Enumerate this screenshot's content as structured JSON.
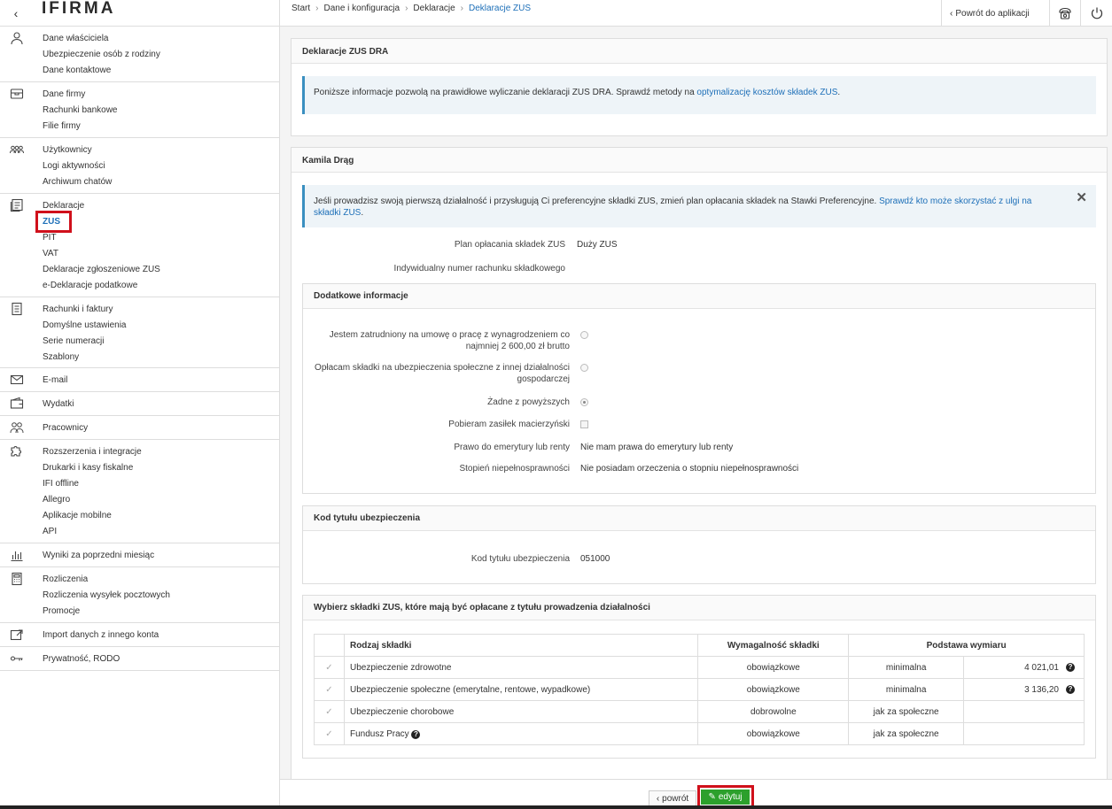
{
  "sidebar": {
    "logo": "IFIRMA",
    "groups": [
      {
        "icon": "user-icon",
        "items": [
          "Dane właściciela",
          "Ubezpieczenie osób z rodziny",
          "Dane kontaktowe"
        ]
      },
      {
        "icon": "company-icon",
        "items": [
          "Dane firmy",
          "Rachunki bankowe",
          "Filie firmy"
        ]
      },
      {
        "icon": "users-icon",
        "items": [
          "Użytkownicy",
          "Logi aktywności",
          "Archiwum chatów"
        ]
      },
      {
        "icon": "declarations-icon",
        "items": [
          "Deklaracje",
          "ZUS",
          "PIT",
          "VAT",
          "Deklaracje zgłoszeniowe ZUS",
          "e-Deklaracje podatkowe"
        ]
      },
      {
        "icon": "invoice-icon",
        "items": [
          "Rachunki i faktury",
          "Domyślne ustawienia",
          "Serie numeracji",
          "Szablony"
        ]
      },
      {
        "icon": "mail-icon",
        "items": [
          "E-mail"
        ]
      },
      {
        "icon": "wallet-icon",
        "items": [
          "Wydatki"
        ]
      },
      {
        "icon": "employees-icon",
        "items": [
          "Pracownicy"
        ]
      },
      {
        "icon": "puzzle-icon",
        "items": [
          "Rozszerzenia i integracje",
          "Drukarki i kasy fiskalne",
          "IFI offline",
          "Allegro",
          "Aplikacje mobilne",
          "API"
        ]
      },
      {
        "icon": "chart-icon",
        "items": [
          "Wyniki za poprzedni miesiąc"
        ]
      },
      {
        "icon": "calculator-icon",
        "items": [
          "Rozliczenia",
          "Rozliczenia wysyłek pocztowych",
          "Promocje"
        ]
      },
      {
        "icon": "import-icon",
        "items": [
          "Import danych z innego konta"
        ]
      },
      {
        "icon": "key-icon",
        "items": [
          "Prywatność, RODO"
        ]
      }
    ]
  },
  "topbar": {
    "breadcrumb": [
      "Start",
      "Dane i konfiguracja",
      "Deklaracje",
      "Deklaracje ZUS"
    ],
    "back_label": "Powrót do aplikacji"
  },
  "panel1": {
    "title": "Deklaracje ZUS DRA",
    "note_text": "Poniższe informacje pozwolą na prawidłowe wyliczanie deklaracji ZUS DRA. Sprawdź metody na ",
    "note_link": "optymalizację kosztów składek ZUS",
    "note_end": "."
  },
  "panel2": {
    "title": "Kamila Drąg",
    "note_text": "Jeśli prowadzisz swoją pierwszą działalność i przysługują Ci preferencyjne składki ZUS, zmień plan opłacania składek na Stawki Preferencyjne. ",
    "note_link": "Sprawdź kto może skorzystać z ulgi na składki ZUS",
    "note_end": ".",
    "plan_label": "Plan opłacania składek ZUS",
    "plan_value": "Duży ZUS",
    "account_label": "Indywidualny numer rachunku składkowego",
    "account_value": ""
  },
  "extra": {
    "title": "Dodatkowe informacje",
    "opt1_line1": "Jestem zatrudniony na umowę o pracę z wynagrodzeniem co",
    "opt1_line2": "najmniej 2 600,00 zł brutto",
    "opt2_line1": "Opłacam składki na ubezpieczenia społeczne z innej działalności",
    "opt2_line2": "gospodarczej",
    "opt3": "Żadne z powyższych",
    "maternity_label": "Pobieram zasiłek macierzyński",
    "pension_label": "Prawo do emerytury lub renty",
    "pension_value": "Nie mam prawa do emerytury lub renty",
    "disability_label": "Stopień niepełnosprawności",
    "disability_value": "Nie posiadam orzeczenia o stopniu niepełnosprawności"
  },
  "code": {
    "title": "Kod tytułu ubezpieczenia",
    "label": "Kod tytułu ubezpieczenia",
    "value": "051000"
  },
  "contrib": {
    "title": "Wybierz składki ZUS, które mają być opłacane z tytułu prowadzenia działalności",
    "headers": [
      "Rodzaj składki",
      "Wymagalność składki",
      "Podstawa wymiaru"
    ],
    "rows": [
      {
        "name": "Ubezpieczenie zdrowotne",
        "req": "obowiązkowe",
        "basis": "minimalna",
        "amount": "4 021,01"
      },
      {
        "name": "Ubezpieczenie społeczne (emerytalne, rentowe, wypadkowe)",
        "req": "obowiązkowe",
        "basis": "minimalna",
        "amount": "3 136,20"
      },
      {
        "name": "Ubezpieczenie chorobowe",
        "req": "dobrowolne",
        "basis": "jak za społeczne",
        "amount": ""
      },
      {
        "name": "Fundusz Pracy",
        "req": "obowiązkowe",
        "basis": "jak za społeczne",
        "amount": ""
      }
    ]
  },
  "footer": {
    "back_label": "powrót",
    "edit_label": "edytuj"
  },
  "colors": {
    "accent": "#1d6fb8",
    "highlight": "#d0101b",
    "edit_button": "#2ca02c"
  }
}
